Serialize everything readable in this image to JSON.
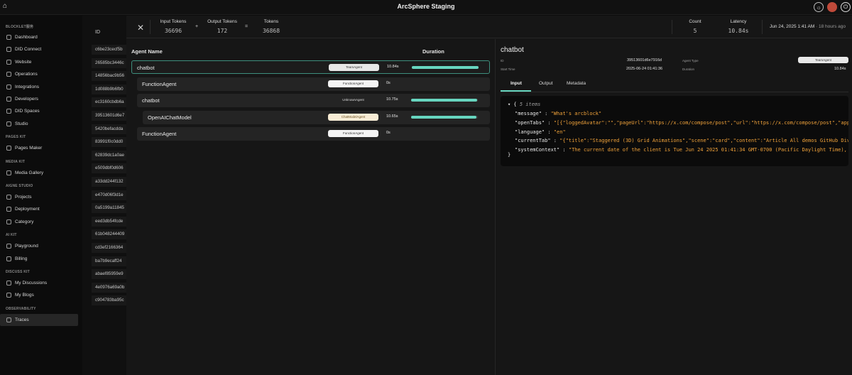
{
  "app": {
    "title": "ArcSphere Staging",
    "colors": {
      "accent": "#67d5bf",
      "string": "#f0a23a"
    },
    "top_icons": [
      "home-icon",
      "sun-icon",
      "avatar",
      "power-icon"
    ]
  },
  "sidebar": {
    "sections": [
      {
        "label": "BLOCKLET服务",
        "items": [
          {
            "label": "Dashboard",
            "icon": "dashboard-icon"
          },
          {
            "label": "DID Connect",
            "icon": "connect-icon"
          },
          {
            "label": "Website",
            "icon": "globe-icon"
          },
          {
            "label": "Operations",
            "icon": "wrench-icon"
          },
          {
            "label": "Integrations",
            "icon": "plug-icon"
          },
          {
            "label": "Developers",
            "icon": "code-icon"
          },
          {
            "label": "DID Spaces",
            "icon": "cloud-icon"
          },
          {
            "label": "Studio",
            "icon": "studio-icon"
          }
        ]
      },
      {
        "label": "PAGES KIT",
        "items": [
          {
            "label": "Pages Maker",
            "icon": "pages-icon"
          }
        ]
      },
      {
        "label": "MEDIA KIT",
        "items": [
          {
            "label": "Media Gallery",
            "icon": "image-icon"
          }
        ]
      },
      {
        "label": "AIGNE STUDIO",
        "items": [
          {
            "label": "Projects",
            "icon": "folder-icon"
          },
          {
            "label": "Deployment",
            "icon": "rocket-icon"
          },
          {
            "label": "Category",
            "icon": "category-icon"
          }
        ]
      },
      {
        "label": "AI KIT",
        "items": [
          {
            "label": "Playground",
            "icon": "play-icon"
          },
          {
            "label": "Billing",
            "icon": "billing-icon"
          }
        ]
      },
      {
        "label": "DISCUSS KIT",
        "items": [
          {
            "label": "My Discussions",
            "icon": "chat-icon"
          },
          {
            "label": "My Blogs",
            "icon": "blog-icon"
          }
        ]
      },
      {
        "label": "OBSERVABILITY",
        "items": [
          {
            "label": "Traces",
            "icon": "traces-icon",
            "active": true
          }
        ]
      }
    ]
  },
  "list": {
    "header": "ID",
    "ids": [
      "c6be23cecf5b",
      "26585bc3446c",
      "14856bac9b56",
      "1d088b9b6fb0",
      "ec3160cbdb6a",
      "39513601d6e7",
      "5420befacdda",
      "83991f0c0dd0",
      "62839dc1a0ae",
      "e509dbf0d606",
      "a33dd244f132",
      "e470d06f3d1e",
      "0a5199a11845",
      "eed3db54fcde",
      "61b048244409",
      "cd3ef2166364",
      "ba7b9ecaff24",
      "abaef85959e9",
      "4e0976a69a0b",
      "c904783ba95c"
    ]
  },
  "header": {
    "input_tokens_label": "Input Tokens",
    "input_tokens": "36696",
    "plus": "+",
    "output_tokens_label": "Output Tokens",
    "output_tokens": "172",
    "equals": "=",
    "tokens_label": "Tokens",
    "tokens": "36868",
    "count_label": "Count",
    "count": "5",
    "latency_label": "Latency",
    "latency": "10.84s",
    "timestamp": "Jun 24, 2025 1:41 AM",
    "ago": " · 18 hours ago"
  },
  "tree": {
    "agent_name_header": "Agent Name",
    "duration_header": "Duration",
    "rows": [
      {
        "name": "chatbot",
        "tag": "TeamAgent",
        "duration": "10.84s",
        "progress": 1.0,
        "selected": true
      },
      {
        "name": "FunctionAgent",
        "tag": "FunctionAgent",
        "duration": "0s",
        "progress": 0
      },
      {
        "name": "chatbot",
        "tag": "UnknownAgent",
        "duration": "10.75s",
        "progress": 0.99
      },
      {
        "name": "OpenAIChatModel",
        "tag": "ChatModelAgent",
        "duration": "10.65s",
        "progress": 0.98
      },
      {
        "name": "FunctionAgent",
        "tag": "FunctionAgent",
        "duration": "0s",
        "progress": 0
      }
    ]
  },
  "detail": {
    "title": "chatbot",
    "id_label": "ID",
    "id_value": "39513601d6e7916d",
    "start_label": "Start Time",
    "start_value": "2025-06-24 01:41:36",
    "type_label": "Agent Type",
    "type_value": "TeamAgent",
    "duration_label": "Duration",
    "duration_value": "10.84s",
    "tabs": [
      "Input",
      "Output",
      "Metadata"
    ],
    "json_summary": "5 items",
    "json": [
      {
        "key": "\"message\"",
        "value": "\"What's arcblock\""
      },
      {
        "key": "\"openTabs\"",
        "value": "\"[{\"loggedAvatar\":\"\",\"pageUrl\":\"https://x.com/compose/post\",\"url\":\"https://x.com/compose/post\",\"appIcon\":"
      },
      {
        "key": "\"language\"",
        "value": "\"en\""
      },
      {
        "key": "\"currentTab\"",
        "value": "\"{\"title\":\"Staggered (3D) Grid Animations\",\"scene\":\"card\",\"content\":\"Article All demos GitHub Divi AI: "
      },
      {
        "key": "\"systemContext\"",
        "value": "\"The current date of the client is Tue Jun 24 2025 01:41:34 GMT-0700 (Pacific Daylight Time), timezo"
      }
    ]
  }
}
